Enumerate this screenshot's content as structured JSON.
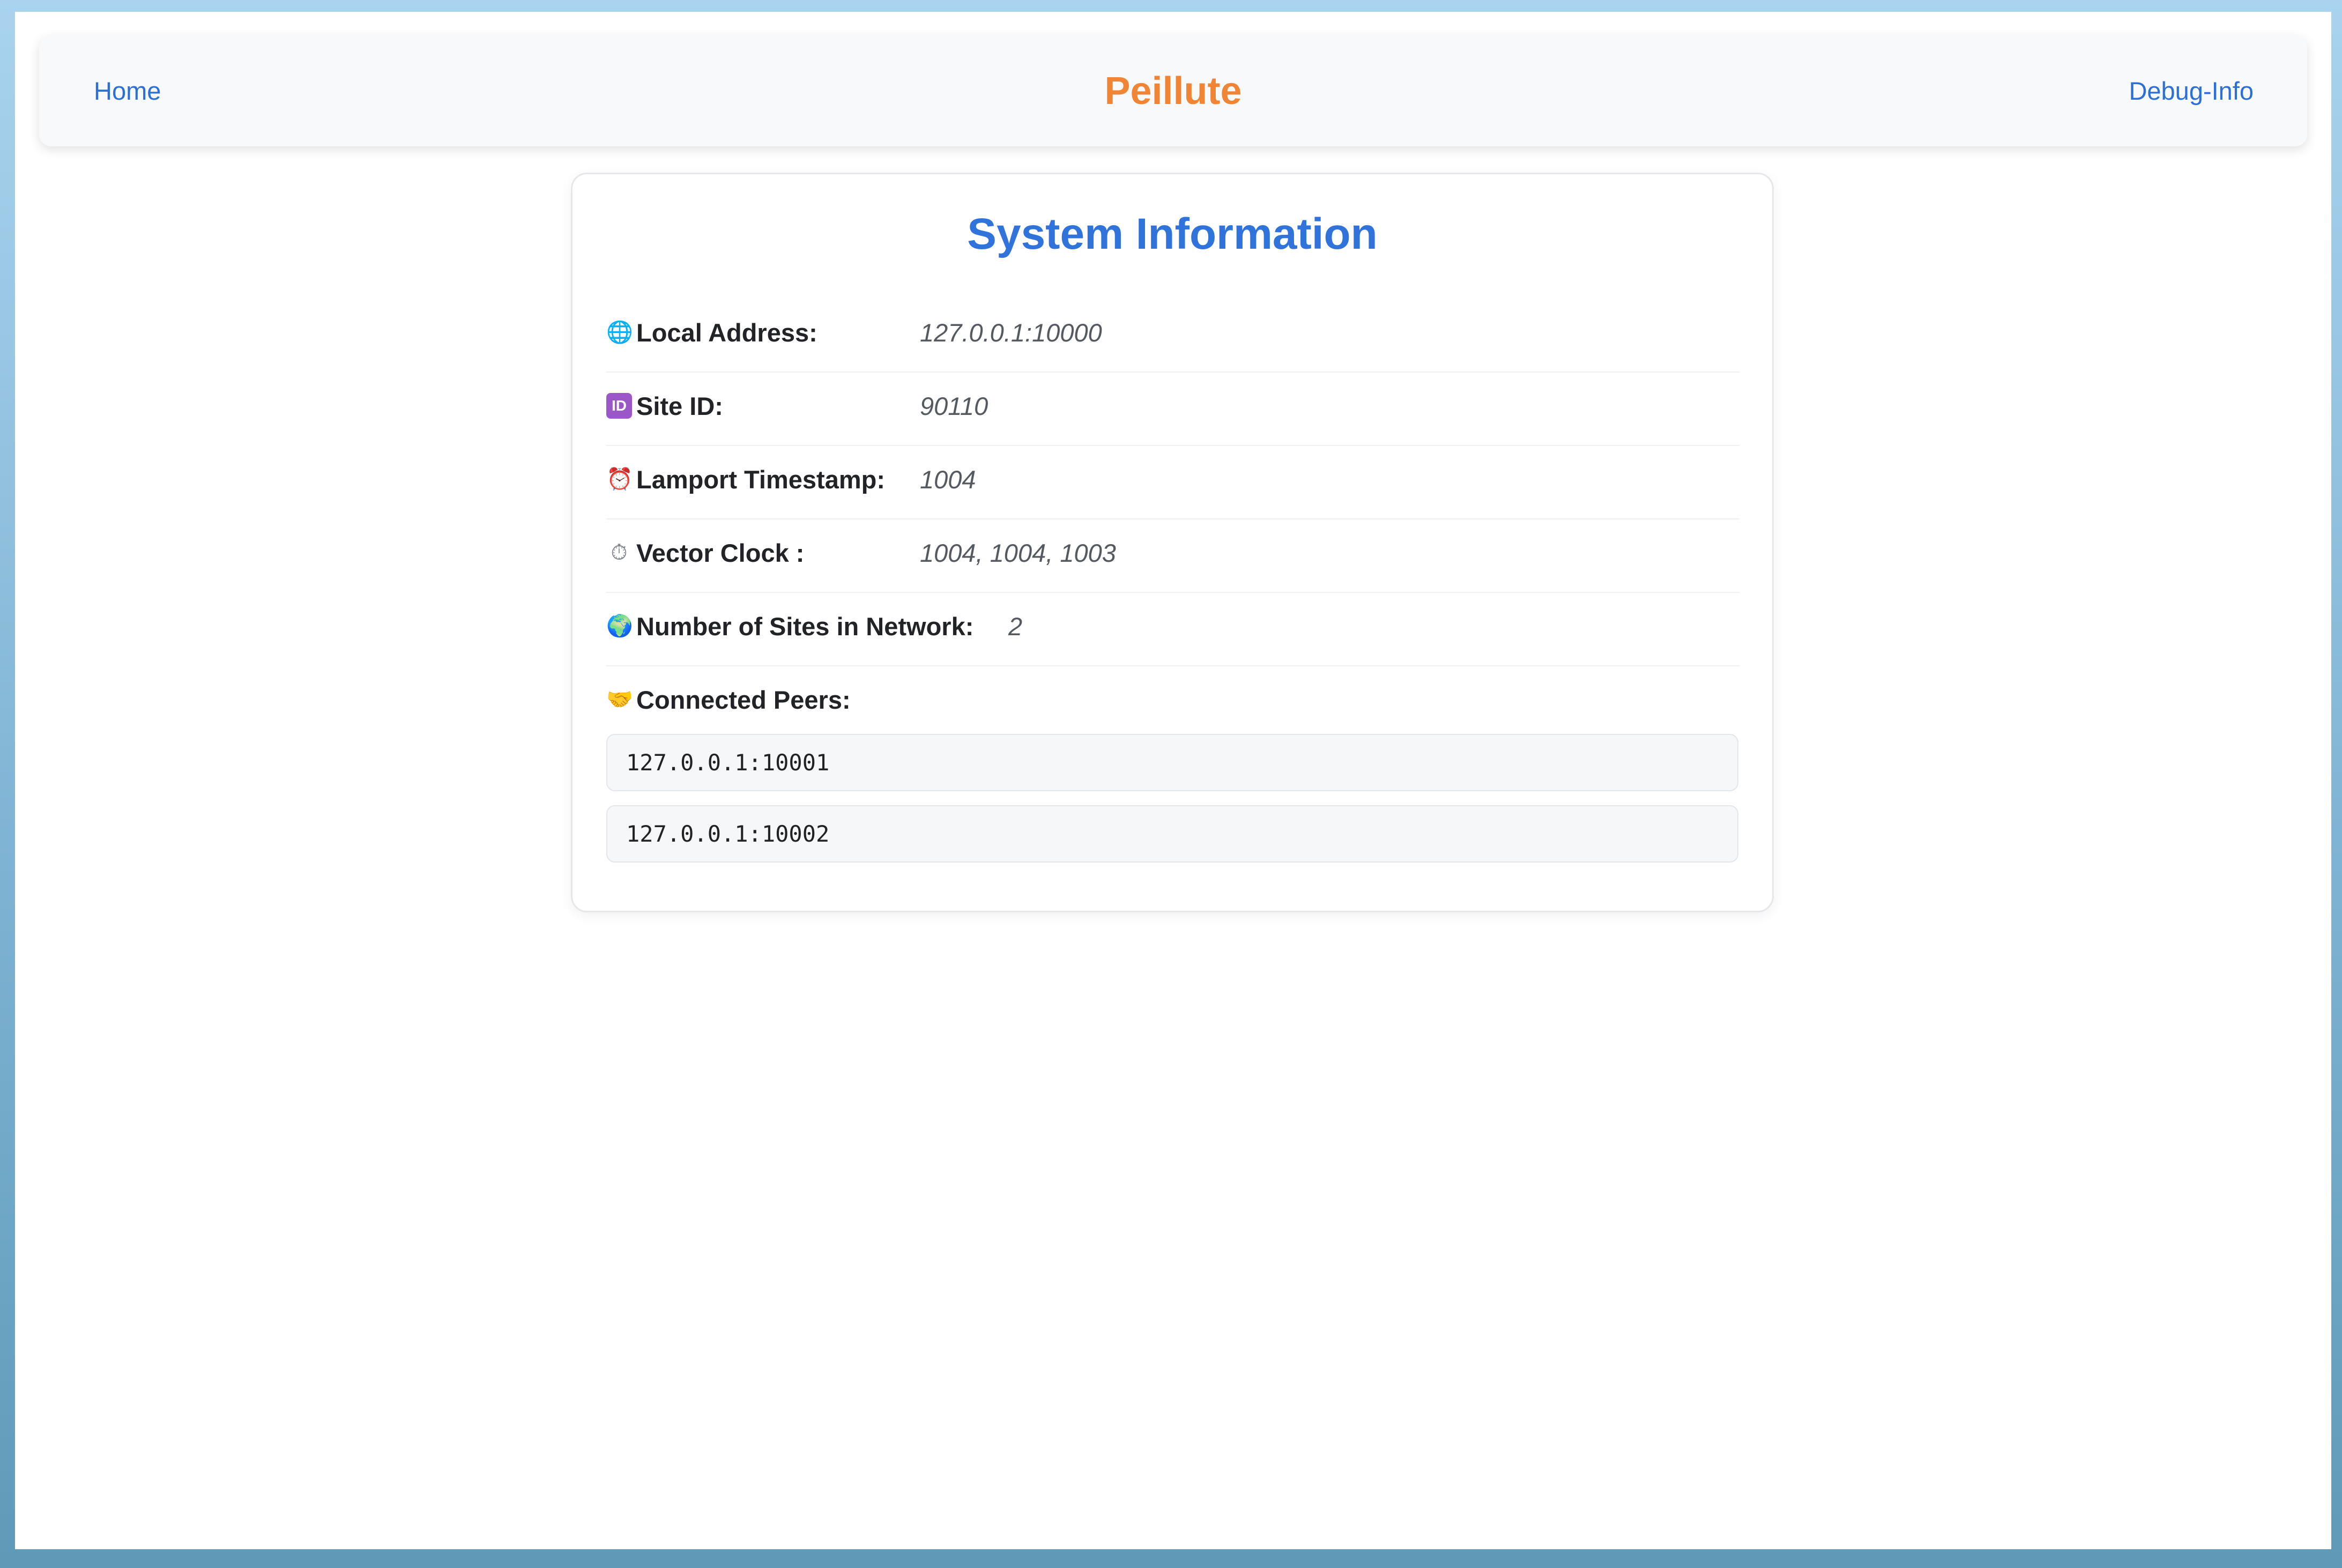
{
  "nav": {
    "home_label": "Home",
    "brand": "Peillute",
    "debug_label": "Debug-Info"
  },
  "card": {
    "title": "System Information",
    "rows": [
      {
        "icon": "globe-icon",
        "label": "Local Address:",
        "value": "127.0.0.1:10000"
      },
      {
        "icon": "id-icon",
        "label": "Site ID:",
        "value": "90110"
      },
      {
        "icon": "alarm-clock-icon",
        "label": "Lamport Timestamp:",
        "value": "1004"
      },
      {
        "icon": "stopwatch-icon",
        "label": "Vector Clock :",
        "value": "1004, 1004, 1003"
      },
      {
        "icon": "earth-globe-icon",
        "label": "Number of Sites in Network:",
        "value": "2"
      }
    ],
    "peers_label": "Connected Peers:",
    "peers": [
      "127.0.0.1:10001",
      "127.0.0.1:10002"
    ]
  },
  "icons": {
    "globe": "🌐",
    "id": "ID",
    "alarm": "⏰",
    "stopwatch": "⏱",
    "earth": "🌍",
    "handshake": "🤝"
  },
  "colors": {
    "brand": "#ef8535",
    "link": "#2c6fd6",
    "title": "#2f73db"
  }
}
